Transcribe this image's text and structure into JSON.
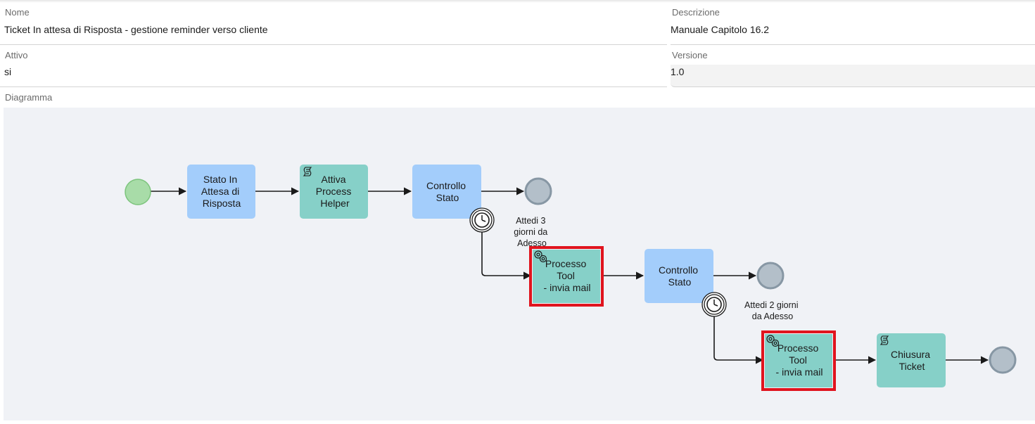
{
  "form": {
    "nome": {
      "label": "Nome",
      "value": "Ticket In attesa di Risposta - gestione reminder verso cliente"
    },
    "descrizione": {
      "label": "Descrizione",
      "value": "Manuale Capitolo 16.2"
    },
    "attivo": {
      "label": "Attivo",
      "value": "si"
    },
    "versione": {
      "label": "Versione",
      "value": "1.0"
    },
    "diagramma": {
      "label": "Diagramma"
    }
  },
  "diagram": {
    "colors": {
      "start_fill": "#a8dca8",
      "start_stroke": "#7cc47c",
      "end_fill": "#b3bfc9",
      "end_stroke": "#8797a4",
      "user_task": "#a3cdfb",
      "script_task": "#86d0c8",
      "highlight": "#e0141e",
      "edge": "#1a1a1a"
    },
    "tasks": {
      "stato_attesa": {
        "lines": [
          "Stato In",
          "Attesa di",
          "Risposta"
        ],
        "kind": "user"
      },
      "attiva_helper": {
        "lines": [
          "Attiva",
          "Process",
          "Helper"
        ],
        "kind": "script",
        "icon": "script-icon"
      },
      "controllo_stato_1": {
        "lines": [
          "Controllo",
          "Stato"
        ],
        "kind": "user"
      },
      "processo_tool_1": {
        "lines": [
          "Processo",
          "Tool",
          " - invia mail"
        ],
        "kind": "service",
        "icon": "gears-icon",
        "highlighted": true
      },
      "controllo_stato_2": {
        "lines": [
          "Controllo",
          "Stato"
        ],
        "kind": "user"
      },
      "processo_tool_2": {
        "lines": [
          "Processo",
          "Tool",
          " - invia mail"
        ],
        "kind": "service",
        "icon": "gears-icon",
        "highlighted": true
      },
      "chiusura_ticket": {
        "lines": [
          "Chiusura",
          "Ticket"
        ],
        "kind": "script",
        "icon": "script-icon"
      }
    },
    "timers": {
      "timer_1": {
        "lines": [
          "Attedi 3",
          "giorni da",
          "Adesso"
        ],
        "icon": "clock-icon"
      },
      "timer_2": {
        "lines": [
          "Attedi 2 giorni",
          "da Adesso"
        ],
        "icon": "clock-icon"
      }
    }
  }
}
